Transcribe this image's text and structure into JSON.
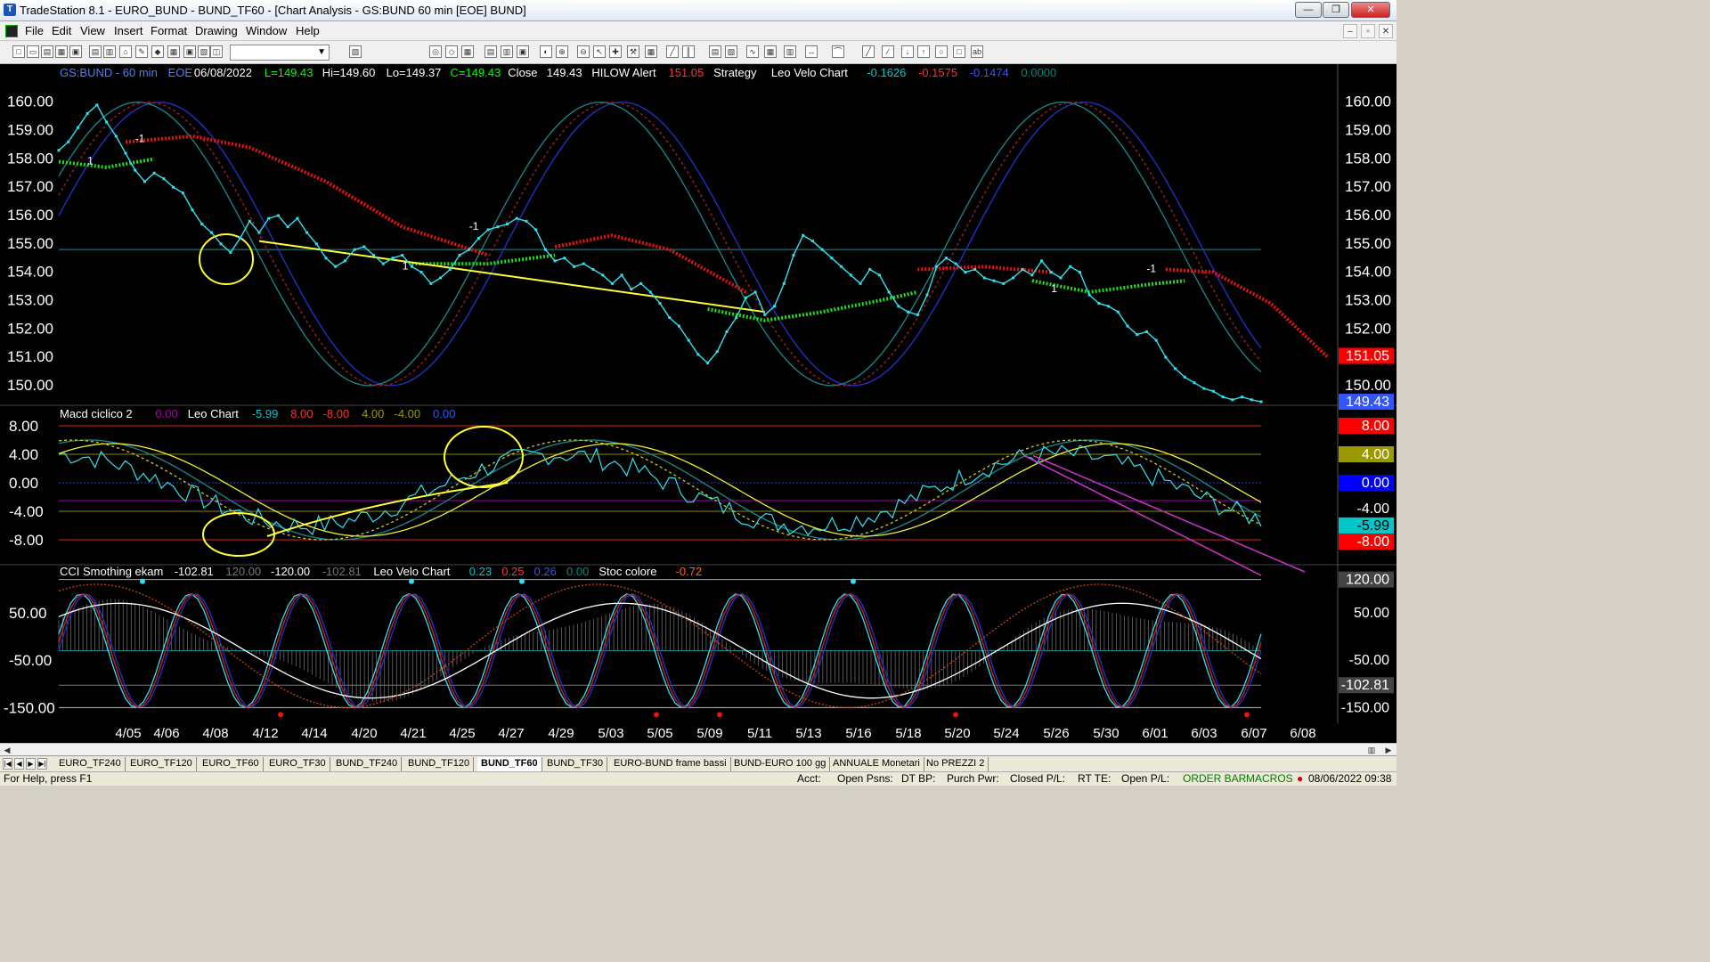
{
  "window": {
    "title": "TradeStation 8.1 - EURO_BUND - BUND_TF60 - [Chart Analysis - GS:BUND  60 min  [EOE] BUND]",
    "min": "—",
    "max": "❐",
    "close": "✕"
  },
  "menu": [
    "File",
    "Edit",
    "View",
    "Insert",
    "Format",
    "Drawing",
    "Window",
    "Help"
  ],
  "mdi_buttons": [
    "–",
    "▫",
    "✕"
  ],
  "toolbar": {
    "symbol_combo": "▼"
  },
  "chart_data": {
    "type": "line",
    "price_panel": {
      "header": [
        "GS:BUND - 60 min",
        "EOE",
        "06/08/2022",
        "L=149.43",
        "Hi=149.60",
        "Lo=149.37",
        "C=149.43",
        "Close",
        "149.43",
        "HILOW Alert",
        "151.05",
        "Strategy",
        "Leo Velo Chart",
        "-0.1626",
        "-0.1575",
        "-0.1474",
        "0.0000"
      ],
      "header_colors": [
        "#4f7fff",
        "#4f7fff",
        "#ffffff",
        "#00ff00",
        "#ffffff",
        "#ffffff",
        "#00ff00",
        "#ffffff",
        "#ffffff",
        "#ffffff",
        "#ff3333",
        "#ffffff",
        "#ffffff",
        "#00c8c8",
        "#ff3333",
        "#3355ff",
        "#008888"
      ],
      "y_ticks": [
        "160.00",
        "159.00",
        "158.00",
        "157.00",
        "156.00",
        "155.00",
        "154.00",
        "153.00",
        "152.00",
        "151.00",
        "150.00"
      ],
      "ylim": [
        149.4,
        160.4
      ],
      "last_hilow": "151.05",
      "last_close": "149.43",
      "signal_labels": [
        "1",
        "-1",
        "1",
        "-1",
        "1",
        "-1"
      ],
      "close_series": [
        158.3,
        158.6,
        159.1,
        159.6,
        159.9,
        159.3,
        158.8,
        158.2,
        157.6,
        157.2,
        157.5,
        157.3,
        157.0,
        156.8,
        156.2,
        155.7,
        155.4,
        155.0,
        154.7,
        155.2,
        155.8,
        155.4,
        155.9,
        156.0,
        155.6,
        155.9,
        155.4,
        155.0,
        154.5,
        154.2,
        154.4,
        154.8,
        154.9,
        154.6,
        154.3,
        154.5,
        154.6,
        154.2,
        154.0,
        153.6,
        153.8,
        154.1,
        154.6,
        154.8,
        155.2,
        155.5,
        155.6,
        155.7,
        155.9,
        155.8,
        155.5,
        154.8,
        154.4,
        154.5,
        154.2,
        154.3,
        154.1,
        153.9,
        153.6,
        153.9,
        153.4,
        153.6,
        153.3,
        152.9,
        152.4,
        152.1,
        151.6,
        151.1,
        150.8,
        151.2,
        151.9,
        152.4,
        153.1,
        153.3,
        152.5,
        152.8,
        153.6,
        154.6,
        155.3,
        155.1,
        154.8,
        154.5,
        154.2,
        153.9,
        153.6,
        154.1,
        153.9,
        153.3,
        152.8,
        152.6,
        152.5,
        153.2,
        154.2,
        154.5,
        154.3,
        154.0,
        154.1,
        153.8,
        153.7,
        153.6,
        153.8,
        154.1,
        153.9,
        154.4,
        154.0,
        153.8,
        154.2,
        154.0,
        153.2,
        152.9,
        152.8,
        152.6,
        152.1,
        151.8,
        151.9,
        151.6,
        151.0,
        150.6,
        150.3,
        150.1,
        149.9,
        149.8,
        149.6,
        149.5,
        149.6,
        149.5,
        149.43
      ],
      "hilow_up_series": [
        [
          0,
          157.9,
          5,
          157.7,
          10,
          158.0
        ],
        [
          37,
          154.3,
          45,
          154.3,
          52,
          154.6
        ],
        [
          68,
          152.7,
          74,
          152.3,
          80,
          152.6,
          86,
          153.0,
          90,
          153.3
        ],
        [
          102,
          153.7,
          108,
          153.3,
          115,
          153.6,
          118,
          153.7
        ]
      ],
      "hilow_down_series": [
        [
          7,
          158.6,
          14,
          158.8,
          20,
          158.4,
          28,
          157.2,
          36,
          155.6,
          45,
          154.6
        ],
        [
          52,
          154.9,
          58,
          155.3,
          64,
          154.8,
          72,
          153.3
        ],
        [
          90,
          154.1,
          97,
          154.2,
          104,
          154.0
        ],
        [
          116,
          154.1,
          121,
          154.0,
          127,
          152.9,
          133,
          151.0
        ]
      ],
      "trend_line": [
        [
          21,
          155.1
        ],
        [
          74,
          152.6
        ]
      ],
      "horizontal_line": 154.8
    },
    "macd_panel": {
      "header": [
        "Macd ciclico 2",
        "0.00",
        "Leo Chart",
        "-5.99",
        "8.00",
        "-8.00",
        "4.00",
        "-4.00",
        "0.00"
      ],
      "header_colors": [
        "#ffffff",
        "#aa00aa",
        "#ffffff",
        "#00c8c8",
        "#ff3333",
        "#ff3333",
        "#9a9a00",
        "#9a9a00",
        "#3355ff"
      ],
      "y_ticks": [
        "8.00",
        "4.00",
        "0.00",
        "-4.00",
        "-8.00"
      ],
      "ylim": [
        -11,
        10
      ],
      "right_labels": [
        "8.00",
        "4.00",
        "0.00",
        "-4.00",
        "-5.99",
        "-8.00"
      ],
      "right_label_bg": [
        "#ff0000",
        "#9a9a00",
        "#0000ff",
        "#000000",
        "#00c8c8",
        "#ff0000"
      ]
    },
    "cci_panel": {
      "header": [
        "CCI Smothing ekam",
        "-102.81",
        "120.00",
        "-120.00",
        "-102.81",
        "Leo Velo Chart",
        "0.23",
        "0.25",
        "0.26",
        "0.00",
        "Stoc colore",
        "-0.72"
      ],
      "header_colors": [
        "#ffffff",
        "#ffffff",
        "#777777",
        "#ffffff",
        "#777777",
        "#ffffff",
        "#00c8c8",
        "#ff3333",
        "#3355ff",
        "#008888",
        "#ffffff",
        "#ff6622"
      ],
      "y_ticks": [
        "50.00",
        "-50.00",
        "-150.00"
      ],
      "ylim": [
        -170,
        140
      ],
      "right_labels": [
        "120.00",
        "50.00",
        "-50.00",
        "-102.81",
        "-150.00"
      ]
    },
    "x_ticks": [
      "4/05",
      "4/06",
      "4/08",
      "4/12",
      "4/14",
      "4/20",
      "4/21",
      "4/25",
      "4/27",
      "4/29",
      "5/03",
      "5/05",
      "5/09",
      "5/11",
      "5/13",
      "5/16",
      "5/18",
      "5/20",
      "5/24",
      "5/26",
      "5/30",
      "6/01",
      "6/03",
      "6/07",
      "6/08"
    ]
  },
  "tabs": [
    "EURO_TF240",
    "EURO_TF120",
    "EURO_TF60",
    "EURO_TF30",
    "BUND_TF240",
    "BUND_TF120",
    "BUND_TF60",
    "BUND_TF30",
    "EURO-BUND frame bassi",
    "BUND-EURO 100 gg",
    "ANNUALE Monetari",
    "No PREZZI 2"
  ],
  "active_tab": "BUND_TF60",
  "status": {
    "help": "For Help, press F1",
    "acct": "Acct:",
    "open_psns": "Open Psns:",
    "dt_bp": "DT BP:",
    "purch_pwr": "Purch Pwr:",
    "closed_pl": "Closed P/L:",
    "rt_te": "RT TE:",
    "open_pl": "Open P/L:",
    "order_bar": "ORDER BAR",
    "macros": "MACROS",
    "datetime": "08/06/2022 09:38",
    "accent_color": "#008000"
  }
}
